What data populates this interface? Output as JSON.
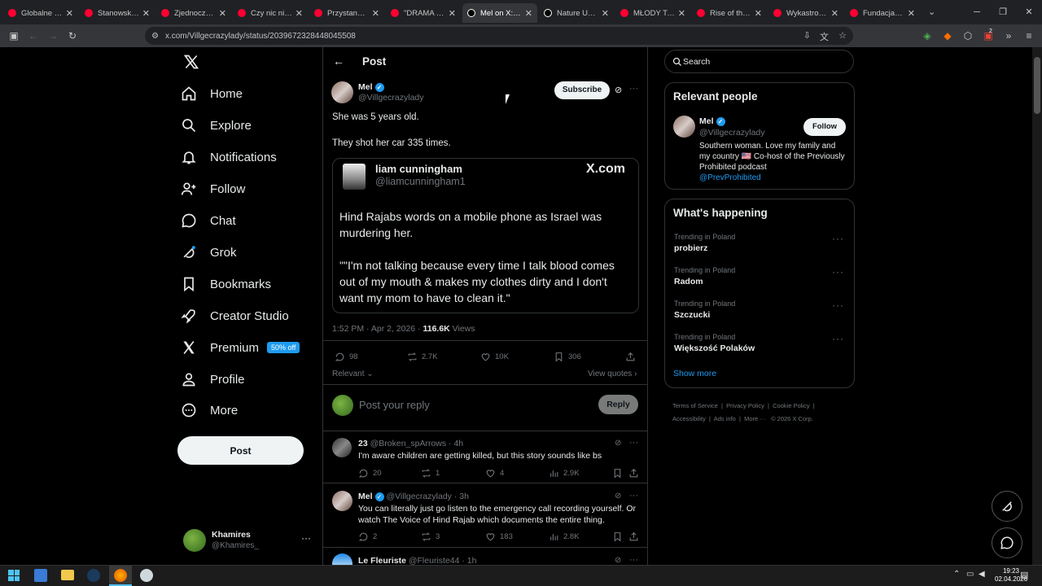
{
  "browser": {
    "tabs": [
      {
        "title": "Globalne Imperium",
        "color": "#ff0033"
      },
      {
        "title": "Stanowski vs W",
        "color": "#ff0033"
      },
      {
        "title": "Zjednoczeni Przy",
        "color": "#ff0033"
      },
      {
        "title": "Czy nic nie dzieje",
        "color": "#ff0033"
      },
      {
        "title": "Przystanek Lom",
        "color": "#ff0033"
      },
      {
        "title": "\"DRAMA WISI W",
        "color": "#ff0033"
      },
      {
        "title": "Mel on X: \"She w",
        "color": "#ffffff",
        "active": true
      },
      {
        "title": "Nature Unedited",
        "color": "#ffffff"
      },
      {
        "title": "MŁODY TATA W",
        "color": "#ff0033"
      },
      {
        "title": "Rise of the Nazi",
        "color": "#ff0033"
      },
      {
        "title": "Wykastrować b",
        "color": "#ff0033"
      },
      {
        "title": "Fundacja ECPU",
        "color": "#ff0033"
      }
    ],
    "url": "x.com/Villgecrazylady/status/2039672328448045508",
    "extension_badge": "2"
  },
  "sidebar": {
    "items": [
      {
        "label": "Home",
        "icon": "home-icon"
      },
      {
        "label": "Explore",
        "icon": "search-icon"
      },
      {
        "label": "Notifications",
        "icon": "bell-icon"
      },
      {
        "label": "Follow",
        "icon": "person-plus-icon"
      },
      {
        "label": "Chat",
        "icon": "chat-icon"
      },
      {
        "label": "Grok",
        "icon": "grok-icon"
      },
      {
        "label": "Bookmarks",
        "icon": "bookmark-icon"
      },
      {
        "label": "Creator Studio",
        "icon": "rocket-icon"
      },
      {
        "label": "Premium",
        "icon": "x-logo-icon"
      },
      {
        "label": "Profile",
        "icon": "profile-icon"
      },
      {
        "label": "More",
        "icon": "more-circle-icon"
      }
    ],
    "premium_badge": "50% off",
    "post_button": "Post",
    "account": {
      "name": "Khamires",
      "handle": "@Khamires_"
    }
  },
  "header": {
    "title": "Post"
  },
  "post": {
    "author": "Mel",
    "handle": "@Villgecrazylady",
    "subscribe": "Subscribe",
    "text1": "She was 5 years old.",
    "text2": "They shot her car 335 times.",
    "embed": {
      "name": "liam cunningham",
      "handle": "@liamcunningham1",
      "logo": "X.com",
      "para1": "Hind Rajabs words on a mobile phone as Israel was murdering her.",
      "para2": "\"\"I'm not talking because every time I talk blood comes out of my mouth  & makes my clothes dirty and I don't want my mom to have to clean it.\""
    },
    "time": "1:52 PM · Apr 2, 2026 · ",
    "views": "116.6K",
    "views_label": " Views",
    "replies": "98",
    "reposts": "2.7K",
    "likes": "10K",
    "bookmarks": "306",
    "relevant": "Relevant",
    "view_quotes": "View quotes"
  },
  "reply_box": {
    "placeholder": "Post your reply",
    "button": "Reply"
  },
  "replies": [
    {
      "name": "23",
      "handle": "@Broken_spArrows · 4h",
      "text": "I'm aware children are getting killed, but this story sounds like bs",
      "replies": "20",
      "reposts": "1",
      "likes": "4",
      "views": "2.9K"
    },
    {
      "name": "Mel",
      "handle": "@Villgecrazylady · 3h",
      "text": "You can literally just go listen to the emergency call recording yourself. Or watch The Voice of Hind Rajab which documents the entire thing.",
      "replies": "2",
      "reposts": "3",
      "likes": "183",
      "views": "2.8K"
    },
    {
      "name": "Le Fleuriste",
      "handle": "@Fleuriste44 · 1h"
    }
  ],
  "search": {
    "placeholder": "Search"
  },
  "relevant_people": {
    "title": "Relevant people",
    "name": "Mel",
    "handle": "@Villgecrazylady",
    "follow": "Follow",
    "bio": "Southern woman. Love my family and my country 🇺🇸 Co-host of the Previously Prohibited podcast",
    "link": "@PrevProhibited"
  },
  "happening": {
    "title": "What's happening",
    "trends": [
      {
        "context": "Trending in Poland",
        "topic": "probierz"
      },
      {
        "context": "Trending in Poland",
        "topic": "Radom"
      },
      {
        "context": "Trending in Poland",
        "topic": "Szczucki"
      },
      {
        "context": "Trending in Poland",
        "topic": "Większość Polaków"
      }
    ],
    "show_more": "Show more"
  },
  "footer": {
    "links": [
      "Terms of Service",
      "Privacy Policy",
      "Cookie Policy",
      "Accessibility",
      "Ads info",
      "More ···"
    ],
    "copyright": "© 2026 X Corp."
  },
  "taskbar": {
    "time": "19:23",
    "date": "02.04.2026"
  },
  "colors": {
    "accent": "#1d9bf0",
    "background": "#000000",
    "text": "#e7e9ea",
    "muted": "#71767b"
  }
}
